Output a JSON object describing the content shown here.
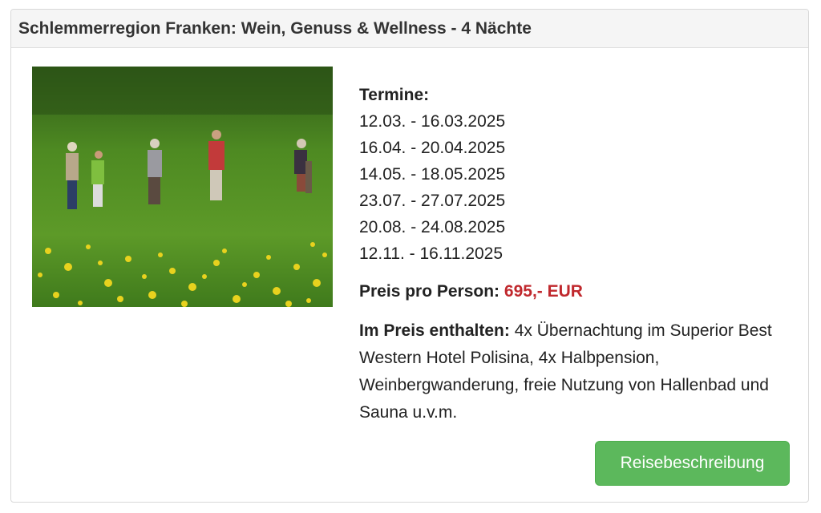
{
  "panel": {
    "title": "Schlemmerregion Franken: Wein, Genuss & Wellness - 4 Nächte"
  },
  "photo": {
    "subject": "hikers-in-meadow-photo"
  },
  "details": {
    "termine_label": "Termine:",
    "dates": [
      "12.03. - 16.03.2025",
      "16.04. - 20.04.2025",
      "14.05. - 18.05.2025",
      "23.07. - 27.07.2025",
      "20.08. - 24.08.2025",
      "12.11. - 16.11.2025"
    ],
    "price_label": "Preis pro Person:",
    "price_value": "695,- EUR",
    "included_label": "Im Preis enthalten:",
    "included_text": "4x Übernachtung im Superior Best Western Hotel Polisina, 4x Halbpension, Weinbergwanderung, freie Nutzung von Hallenbad und Sauna u.v.m."
  },
  "actions": {
    "travel_description_label": "Reisebeschreibung"
  },
  "colors": {
    "price": "#c0282d",
    "button": "#5cb85c",
    "heading_bg": "#f5f5f5"
  }
}
